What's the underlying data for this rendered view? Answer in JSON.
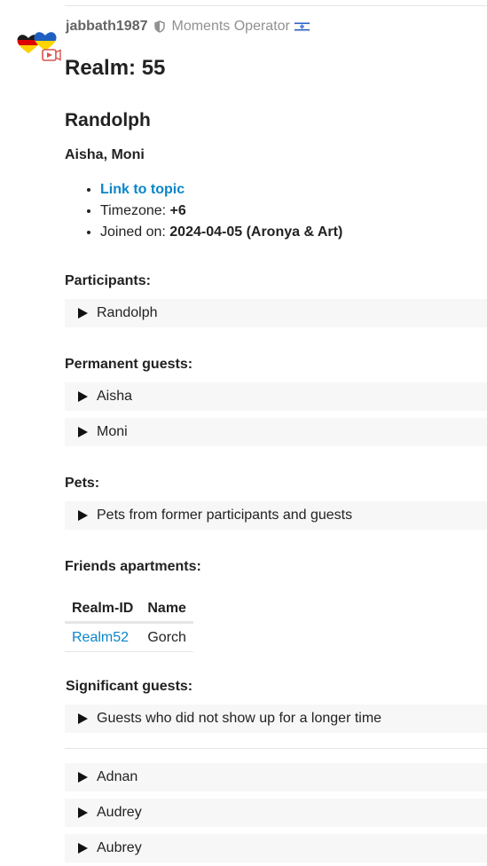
{
  "author": {
    "username": "jabbath1987",
    "title": "Moments Operator"
  },
  "post": {
    "heading": "Realm: 55",
    "subheading": "Randolph",
    "names": "Aisha, Moni",
    "meta": {
      "link_label": "Link to topic",
      "timezone_label": "Timezone: ",
      "timezone_value": "+6",
      "joined_label": "Joined on: ",
      "joined_value": "2024-04-05 (Aronya & Art)"
    },
    "participants": {
      "label": "Participants:",
      "items": [
        "Randolph"
      ]
    },
    "permanent_guests": {
      "label": "Permanent guests:",
      "items": [
        "Aisha",
        "Moni"
      ]
    },
    "pets": {
      "label": "Pets:",
      "items": [
        "Pets from former participants and guests"
      ]
    },
    "friends_apartments": {
      "label": "Friends apartments:",
      "columns": [
        "Realm-ID",
        "Name"
      ],
      "rows": [
        {
          "id": "Realm52",
          "name": "Gorch"
        }
      ]
    },
    "significant_guests": {
      "label": "Significant guests:",
      "items": [
        "Guests who did not show up for a longer time"
      ]
    },
    "more_guests": [
      "Adnan",
      "Audrey",
      "Aubrey"
    ]
  },
  "colors": {
    "link": "#0a86c9",
    "username": "#646464",
    "usertitle": "#919191",
    "details_bg": "#f7f7f7"
  },
  "icons": {
    "avatar": "flag-heart-avatar",
    "shield": "shield-icon",
    "flag": "israel-flag-icon",
    "disclosure": "triangle-right-icon"
  }
}
